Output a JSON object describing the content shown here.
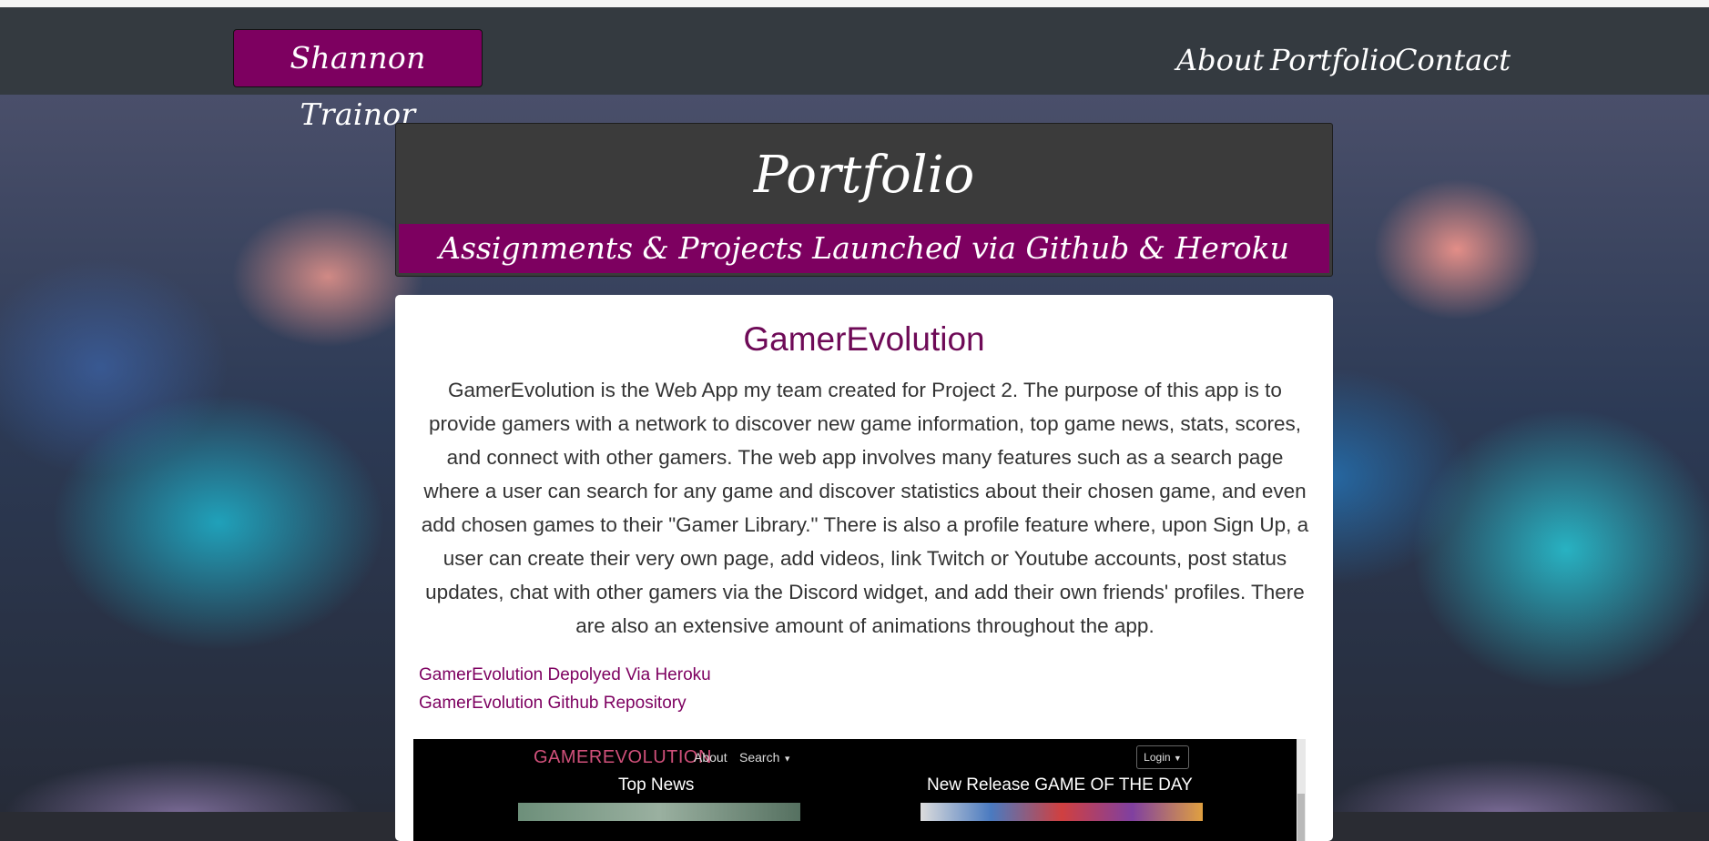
{
  "navbar": {
    "brand": "Shannon Trainor",
    "links": [
      "About",
      "Portfolio",
      "Contact"
    ]
  },
  "header": {
    "title": "Portfolio",
    "subtitle": "Assignments & Projects Launched via Github & Heroku"
  },
  "project": {
    "title": "GamerEvolution",
    "description": "GamerEvolution is the Web App my team created for Project 2. The purpose of this app is to provide gamers with a network to discover new game information, top game news, stats, scores, and connect with other gamers. The web app involves many features such as a search page where a user can search for any game and discover statistics about their chosen game, and even add chosen games to their \"Gamer Library.\" There is also a profile feature where, upon Sign Up, a user can create their very own page, add videos, link Twitch or Youtube accounts, post status updates, chat with other gamers via the Discord widget, and add their own friends' profiles. There are also an extensive amount of animations throughout the app.",
    "links": [
      "GamerEvolution Depolyed Via Heroku",
      "GamerEvolution Github Repository"
    ]
  },
  "screenshot": {
    "logo": "GAMEREVOLUTION",
    "nav_about": "About",
    "nav_search": "Search",
    "login": "Login",
    "top_news": "Top News",
    "game_of_day": "New Release GAME OF THE DAY"
  },
  "colors": {
    "brand": "#7d0060",
    "navbar_bg": "#343a40",
    "header_card_bg": "#3b3b3b",
    "project_title": "#6e0a57"
  }
}
